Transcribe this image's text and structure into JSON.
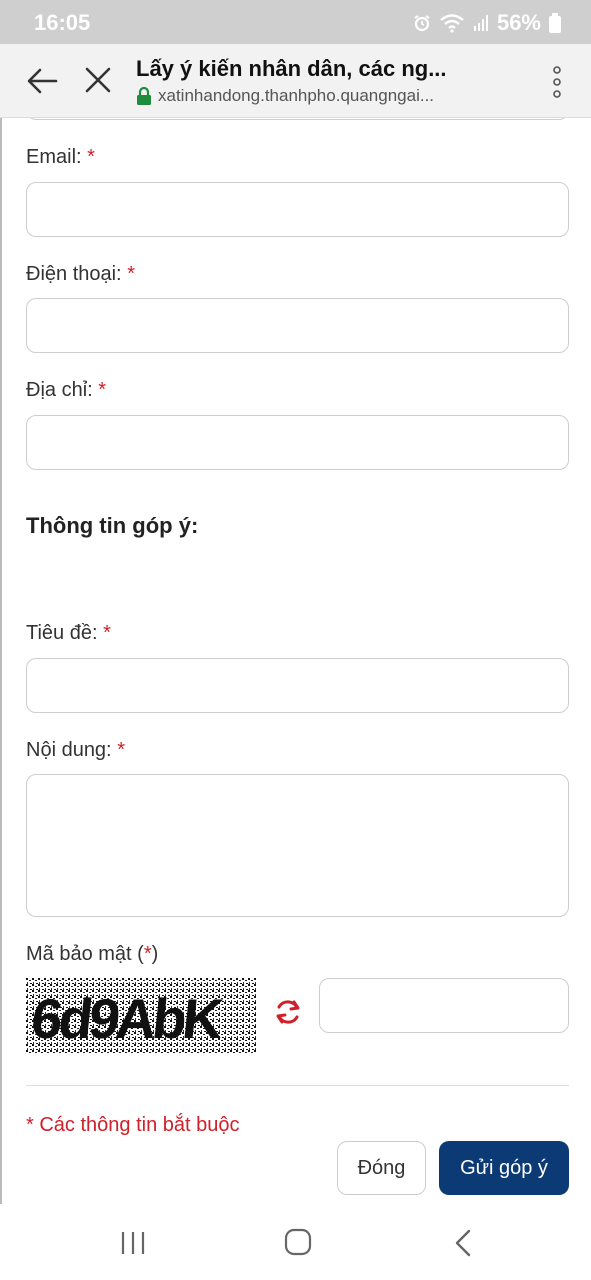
{
  "status_bar": {
    "time": "16:05",
    "battery": "56%",
    "icons": [
      "alarm-icon",
      "wifi-icon",
      "signal-icon",
      "battery-icon"
    ]
  },
  "browser": {
    "page_title": "Lấy ý kiến nhân dân, các ng...",
    "url": "xatinhandong.thanhpho.quangngai...",
    "icons": [
      "back-arrow-icon",
      "close-icon",
      "lock-icon",
      "more-vert-icon"
    ]
  },
  "form": {
    "email_label": "Email:",
    "phone_label": "Điện thoại:",
    "address_label": "Địa chỉ:",
    "section_title": "Thông tin góp ý:",
    "subject_label": "Tiêu đề:",
    "content_label": "Nội dung:",
    "captcha_label_prefix": "Mã bảo mật (",
    "captcha_label_star": "*",
    "captcha_label_suffix": ")",
    "captcha_text": "6d9AbK",
    "required_star": "*",
    "required_note": "* Các thông tin bắt buộc",
    "close_button": "Đóng",
    "submit_button": "Gửi góp ý"
  },
  "colors": {
    "accent": "#0b3a74",
    "required": "#d0202a",
    "lock": "#1e8e3e"
  }
}
